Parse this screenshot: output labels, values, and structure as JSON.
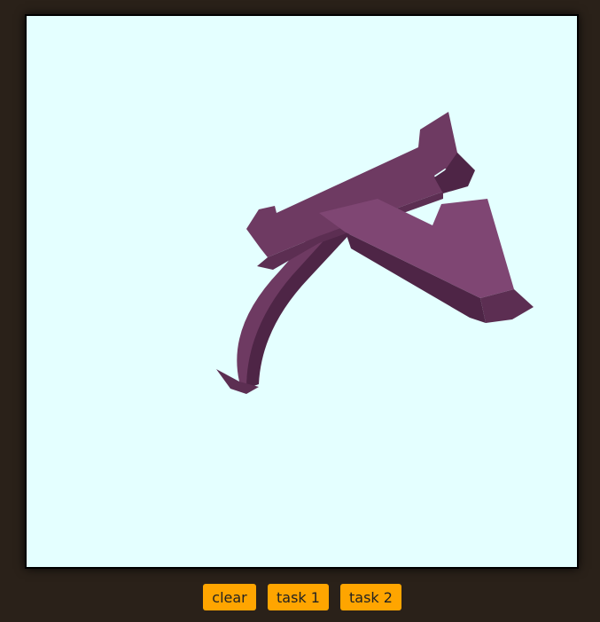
{
  "colors": {
    "page_background": "#2a2119",
    "canvas_background": "#e4ffff",
    "canvas_border": "#000000",
    "button_background": "#ffa500",
    "button_text": "#222222",
    "shape_top": "#6e3a62",
    "shape_side": "#4e2546",
    "shape_highlight": "#7f4673"
  },
  "viewport": {
    "content": "3d-extruded-glyph"
  },
  "buttons": [
    {
      "label": "clear"
    },
    {
      "label": "task 1"
    },
    {
      "label": "task 2"
    }
  ]
}
